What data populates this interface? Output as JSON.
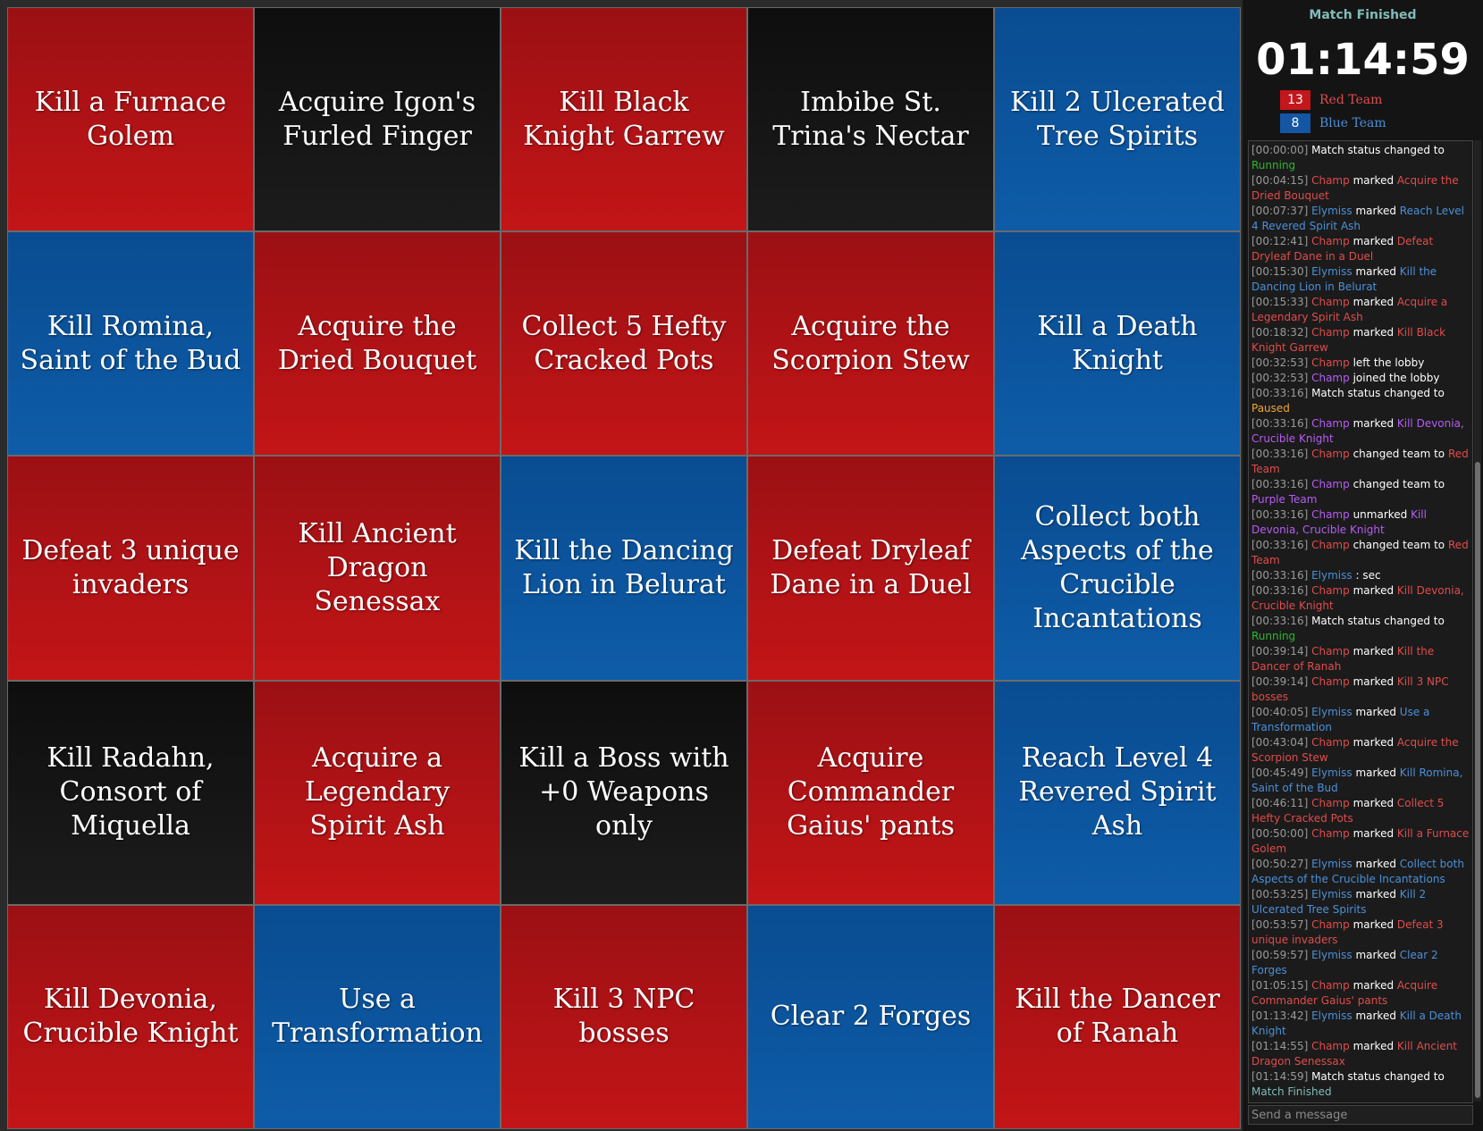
{
  "colors": {
    "red": "#e04c4c",
    "blue": "#4a90d9",
    "purple": "#b55df2",
    "green": "#2fb52f",
    "orange": "#f2a735",
    "teal": "#7fbcb8"
  },
  "board": [
    {
      "label": "Kill a Furnace Golem",
      "team": "red"
    },
    {
      "label": "Acquire Igon's Furled Finger",
      "team": "none"
    },
    {
      "label": "Kill Black Knight Garrew",
      "team": "red"
    },
    {
      "label": "Imbibe St. Trina's Nectar",
      "team": "none"
    },
    {
      "label": "Kill 2 Ulcerated Tree Spirits",
      "team": "blue"
    },
    {
      "label": "Kill Romina, Saint of the Bud",
      "team": "blue"
    },
    {
      "label": "Acquire the Dried Bouquet",
      "team": "red"
    },
    {
      "label": "Collect 5 Hefty Cracked Pots",
      "team": "red"
    },
    {
      "label": "Acquire the Scorpion Stew",
      "team": "red"
    },
    {
      "label": "Kill a Death Knight",
      "team": "blue"
    },
    {
      "label": "Defeat 3 unique invaders",
      "team": "red"
    },
    {
      "label": "Kill Ancient Dragon Senessax",
      "team": "red"
    },
    {
      "label": "Kill the Dancing Lion in Belurat",
      "team": "blue"
    },
    {
      "label": "Defeat Dryleaf Dane in a Duel",
      "team": "red"
    },
    {
      "label": "Collect both Aspects of the Crucible Incantations",
      "team": "blue"
    },
    {
      "label": "Kill Radahn, Consort of Miquella",
      "team": "none"
    },
    {
      "label": "Acquire a Legendary Spirit Ash",
      "team": "red"
    },
    {
      "label": "Kill a Boss with +0 Weapons only",
      "team": "none"
    },
    {
      "label": "Acquire Commander Gaius' pants",
      "team": "red"
    },
    {
      "label": "Reach Level 4 Revered Spirit Ash",
      "team": "blue"
    },
    {
      "label": "Kill Devonia, Crucible Knight",
      "team": "red"
    },
    {
      "label": "Use a Transformation",
      "team": "blue"
    },
    {
      "label": "Kill 3 NPC bosses",
      "team": "red"
    },
    {
      "label": "Clear 2 Forges",
      "team": "blue"
    },
    {
      "label": "Kill the Dancer of Ranah",
      "team": "red"
    }
  ],
  "sidebar": {
    "status": "Match Finished",
    "timer": "01:14:59",
    "teams": [
      {
        "score": "13",
        "name": "Red Team"
      },
      {
        "score": "8",
        "name": "Blue Team"
      }
    ],
    "message_placeholder": "Send a message"
  },
  "chat": [
    {
      "ts": "[00:00:00]",
      "parts": [
        {
          "t": " Match status changed to "
        },
        {
          "t": "Running",
          "c": "green"
        }
      ]
    },
    {
      "ts": "[00:04:15]",
      "parts": [
        {
          "t": " "
        },
        {
          "t": "Champ",
          "c": "red"
        },
        {
          "t": " marked "
        },
        {
          "t": "Acquire the Dried Bouquet",
          "c": "red"
        }
      ]
    },
    {
      "ts": "[00:07:37]",
      "parts": [
        {
          "t": " "
        },
        {
          "t": "Elymiss",
          "c": "blue"
        },
        {
          "t": " marked "
        },
        {
          "t": "Reach Level 4 Revered Spirit Ash",
          "c": "blue"
        }
      ]
    },
    {
      "ts": "[00:12:41]",
      "parts": [
        {
          "t": " "
        },
        {
          "t": "Champ",
          "c": "red"
        },
        {
          "t": " marked "
        },
        {
          "t": "Defeat Dryleaf Dane in a Duel",
          "c": "red"
        }
      ]
    },
    {
      "ts": "[00:15:30]",
      "parts": [
        {
          "t": " "
        },
        {
          "t": "Elymiss",
          "c": "blue"
        },
        {
          "t": " marked "
        },
        {
          "t": "Kill the Dancing Lion in Belurat",
          "c": "blue"
        }
      ]
    },
    {
      "ts": "[00:15:33]",
      "parts": [
        {
          "t": " "
        },
        {
          "t": "Champ",
          "c": "red"
        },
        {
          "t": " marked "
        },
        {
          "t": "Acquire a Legendary Spirit Ash",
          "c": "red"
        }
      ]
    },
    {
      "ts": "[00:18:32]",
      "parts": [
        {
          "t": " "
        },
        {
          "t": "Champ",
          "c": "red"
        },
        {
          "t": " marked "
        },
        {
          "t": "Kill Black Knight Garrew",
          "c": "red"
        }
      ]
    },
    {
      "ts": "[00:32:53]",
      "parts": [
        {
          "t": " "
        },
        {
          "t": "Champ",
          "c": "red"
        },
        {
          "t": " left the lobby"
        }
      ]
    },
    {
      "ts": "[00:32:53]",
      "parts": [
        {
          "t": " "
        },
        {
          "t": "Champ",
          "c": "purple"
        },
        {
          "t": " joined the lobby"
        }
      ]
    },
    {
      "ts": "[00:33:16]",
      "parts": [
        {
          "t": " Match status changed to "
        },
        {
          "t": "Paused",
          "c": "orange"
        }
      ]
    },
    {
      "ts": "[00:33:16]",
      "parts": [
        {
          "t": " "
        },
        {
          "t": "Champ",
          "c": "purple"
        },
        {
          "t": " marked "
        },
        {
          "t": "Kill Devonia, Crucible Knight",
          "c": "purple"
        }
      ]
    },
    {
      "ts": "[00:33:16]",
      "parts": [
        {
          "t": " "
        },
        {
          "t": "Champ",
          "c": "red"
        },
        {
          "t": " changed team to "
        },
        {
          "t": "Red Team",
          "c": "red"
        }
      ]
    },
    {
      "ts": "[00:33:16]",
      "parts": [
        {
          "t": " "
        },
        {
          "t": "Champ",
          "c": "purple"
        },
        {
          "t": " changed team to "
        },
        {
          "t": "Purple Team",
          "c": "purple"
        }
      ]
    },
    {
      "ts": "[00:33:16]",
      "parts": [
        {
          "t": " "
        },
        {
          "t": "Champ",
          "c": "purple"
        },
        {
          "t": " unmarked "
        },
        {
          "t": "Kill Devonia, Crucible Knight",
          "c": "purple"
        }
      ]
    },
    {
      "ts": "[00:33:16]",
      "parts": [
        {
          "t": " "
        },
        {
          "t": "Champ",
          "c": "red"
        },
        {
          "t": " changed team to "
        },
        {
          "t": "Red Team",
          "c": "red"
        }
      ]
    },
    {
      "ts": "[00:33:16]",
      "parts": [
        {
          "t": " "
        },
        {
          "t": "Elymiss",
          "c": "blue"
        },
        {
          "t": " : sec"
        }
      ]
    },
    {
      "ts": "[00:33:16]",
      "parts": [
        {
          "t": " "
        },
        {
          "t": "Champ",
          "c": "red"
        },
        {
          "t": " marked "
        },
        {
          "t": "Kill Devonia, Crucible Knight",
          "c": "red"
        }
      ]
    },
    {
      "ts": "[00:33:16]",
      "parts": [
        {
          "t": " Match status changed to "
        },
        {
          "t": "Running",
          "c": "green"
        }
      ]
    },
    {
      "ts": "[00:39:14]",
      "parts": [
        {
          "t": " "
        },
        {
          "t": "Champ",
          "c": "red"
        },
        {
          "t": " marked "
        },
        {
          "t": "Kill the Dancer of Ranah",
          "c": "red"
        }
      ]
    },
    {
      "ts": "[00:39:14]",
      "parts": [
        {
          "t": " "
        },
        {
          "t": "Champ",
          "c": "red"
        },
        {
          "t": " marked "
        },
        {
          "t": "Kill 3 NPC bosses",
          "c": "red"
        }
      ]
    },
    {
      "ts": "[00:40:05]",
      "parts": [
        {
          "t": " "
        },
        {
          "t": "Elymiss",
          "c": "blue"
        },
        {
          "t": " marked "
        },
        {
          "t": "Use a Transformation",
          "c": "blue"
        }
      ]
    },
    {
      "ts": "[00:43:04]",
      "parts": [
        {
          "t": " "
        },
        {
          "t": "Champ",
          "c": "red"
        },
        {
          "t": " marked "
        },
        {
          "t": "Acquire the Scorpion Stew",
          "c": "red"
        }
      ]
    },
    {
      "ts": "[00:45:49]",
      "parts": [
        {
          "t": " "
        },
        {
          "t": "Elymiss",
          "c": "blue"
        },
        {
          "t": " marked "
        },
        {
          "t": "Kill Romina, Saint of the Bud",
          "c": "blue"
        }
      ]
    },
    {
      "ts": "[00:46:11]",
      "parts": [
        {
          "t": " "
        },
        {
          "t": "Champ",
          "c": "red"
        },
        {
          "t": " marked "
        },
        {
          "t": "Collect 5 Hefty Cracked Pots",
          "c": "red"
        }
      ]
    },
    {
      "ts": "[00:50:00]",
      "parts": [
        {
          "t": " "
        },
        {
          "t": "Champ",
          "c": "red"
        },
        {
          "t": " marked "
        },
        {
          "t": "Kill a Furnace Golem",
          "c": "red"
        }
      ]
    },
    {
      "ts": "[00:50:27]",
      "parts": [
        {
          "t": " "
        },
        {
          "t": "Elymiss",
          "c": "blue"
        },
        {
          "t": " marked "
        },
        {
          "t": "Collect both Aspects of the Crucible Incantations",
          "c": "blue"
        }
      ]
    },
    {
      "ts": "[00:53:25]",
      "parts": [
        {
          "t": " "
        },
        {
          "t": "Elymiss",
          "c": "blue"
        },
        {
          "t": " marked "
        },
        {
          "t": "Kill 2 Ulcerated Tree Spirits",
          "c": "blue"
        }
      ]
    },
    {
      "ts": "[00:53:57]",
      "parts": [
        {
          "t": " "
        },
        {
          "t": "Champ",
          "c": "red"
        },
        {
          "t": " marked "
        },
        {
          "t": "Defeat 3 unique invaders",
          "c": "red"
        }
      ]
    },
    {
      "ts": "[00:59:57]",
      "parts": [
        {
          "t": " "
        },
        {
          "t": "Elymiss",
          "c": "blue"
        },
        {
          "t": " marked "
        },
        {
          "t": "Clear 2 Forges",
          "c": "blue"
        }
      ]
    },
    {
      "ts": "[01:05:15]",
      "parts": [
        {
          "t": " "
        },
        {
          "t": "Champ",
          "c": "red"
        },
        {
          "t": " marked "
        },
        {
          "t": "Acquire Commander Gaius' pants",
          "c": "red"
        }
      ]
    },
    {
      "ts": "[01:13:42]",
      "parts": [
        {
          "t": " "
        },
        {
          "t": "Elymiss",
          "c": "blue"
        },
        {
          "t": " marked "
        },
        {
          "t": "Kill a Death Knight",
          "c": "blue"
        }
      ]
    },
    {
      "ts": "[01:14:55]",
      "parts": [
        {
          "t": " "
        },
        {
          "t": "Champ",
          "c": "red"
        },
        {
          "t": " marked "
        },
        {
          "t": "Kill Ancient Dragon Senessax",
          "c": "red"
        }
      ]
    },
    {
      "ts": "[01:14:59]",
      "parts": [
        {
          "t": " Match status changed to "
        },
        {
          "t": "Match Finished",
          "c": "teal"
        }
      ]
    }
  ]
}
